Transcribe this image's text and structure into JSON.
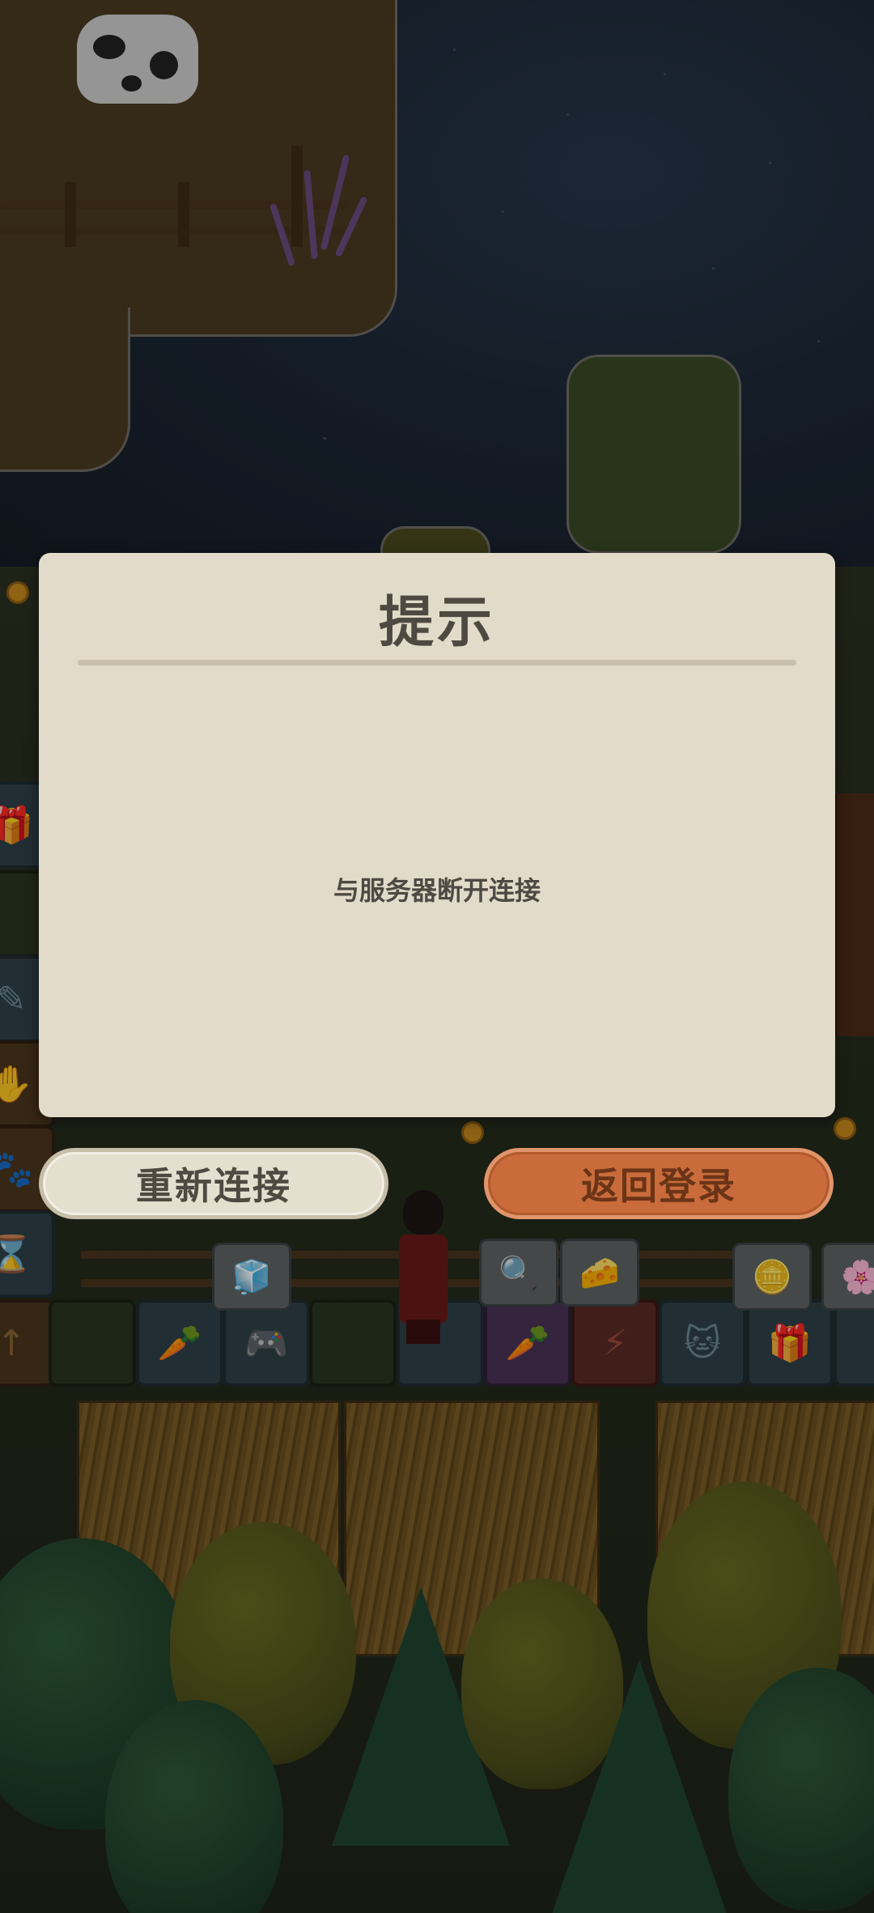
{
  "dialog": {
    "title": "提示",
    "message": "与服务器断开连接"
  },
  "buttons": {
    "reconnect": "重新连接",
    "return_login": "返回登录"
  },
  "colors": {
    "dialog_bg": "#e2dbc9",
    "title_text": "#4f4a41",
    "primary_button": "#c96b3a",
    "secondary_button": "#e5dfcf"
  },
  "icons": {
    "toolbar": [
      "gift-icon",
      "carrot-icon",
      "gamepad-icon",
      "ice-bucket-icon",
      "magnifier-icon",
      "cheese-icon",
      "coin-icon",
      "lightning-icon",
      "cat-icon",
      "flower-branch-icon"
    ]
  }
}
